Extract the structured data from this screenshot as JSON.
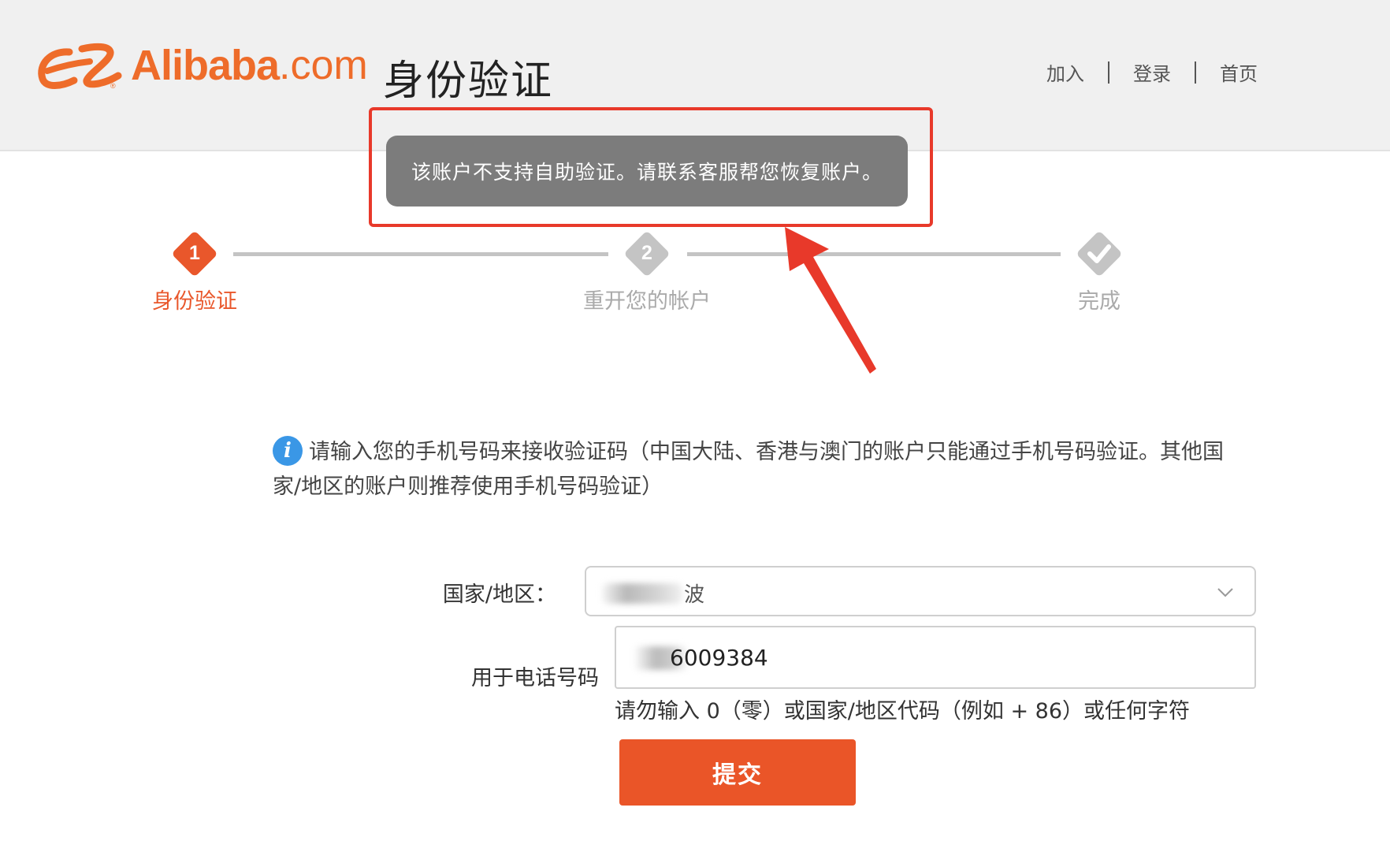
{
  "header": {
    "logo": {
      "brand": "Alibaba",
      "domain_suffix": ".com",
      "registered_mark": "®"
    },
    "page_title": "身份验证",
    "nav": [
      {
        "label": "加入"
      },
      {
        "label": "登录"
      },
      {
        "label": "首页"
      }
    ]
  },
  "toast": {
    "message": "该账户不支持自助验证。请联系客服帮您恢复账户。"
  },
  "steps": [
    {
      "number": "1",
      "label": "身份验证",
      "state": "active"
    },
    {
      "number": "2",
      "label": "重开您的帐户",
      "state": "inactive"
    },
    {
      "number": "",
      "label": "完成",
      "state": "inactive",
      "icon": "checkmark-icon"
    }
  ],
  "info": {
    "icon_glyph": "i",
    "text": "请输入您的手机号码来接收验证码（中国大陆、香港与澳门的账户只能通过手机号码验证。其他国家/地区的账户则推荐使用手机号码验证）"
  },
  "form": {
    "country_label": "国家/地区：",
    "country_value": "波",
    "phone_label": "用于电话号码",
    "phone_value": "6009384",
    "phone_hint": "请勿输入 0（零）或国家/地区代码（例如 + 86）或任何字符",
    "submit_label": "提交"
  },
  "colors": {
    "brand_orange": "#ee6c2a",
    "active_step": "#e9572b",
    "inactive_step": "#c4c4c4",
    "highlight_red": "#e8392a",
    "toast_bg": "#7c7c7c",
    "submit_bg": "#ea5528",
    "info_blue": "#3a97e6"
  }
}
